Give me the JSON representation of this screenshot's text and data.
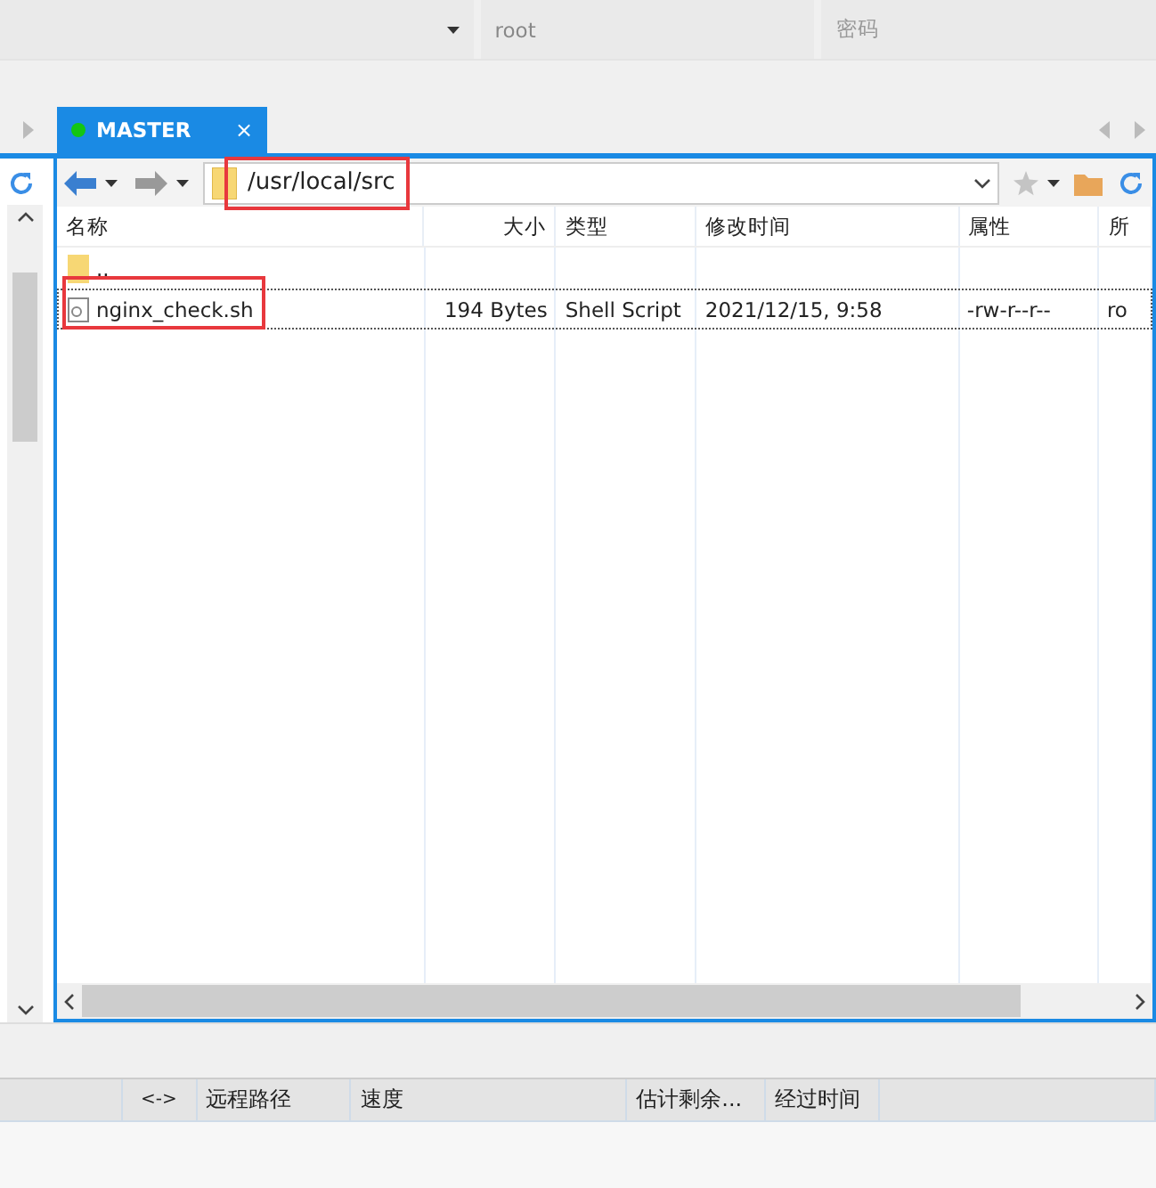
{
  "top_bar": {
    "username": "root",
    "password_placeholder": "密码"
  },
  "tab": {
    "label": "MASTER",
    "close": "×",
    "connected": true,
    "selected": true
  },
  "path_bar": {
    "path": "/usr/local/src"
  },
  "file_list": {
    "columns": [
      "名称",
      "大小",
      "类型",
      "修改时间",
      "属性",
      "所"
    ],
    "rows": [
      {
        "kind": "folder",
        "name": "..",
        "size": "",
        "type": "",
        "modified": "",
        "attributes": "",
        "owner": "",
        "selected": false
      },
      {
        "kind": "file",
        "name": "nginx_check.sh",
        "size": "194 Bytes",
        "type": "Shell Script",
        "modified": "2021/12/15, 9:58",
        "attributes": "-rw-r--r--",
        "owner": "ro",
        "selected": true
      }
    ]
  },
  "transfer_columns": [
    "<->",
    "远程路径",
    "速度",
    "估计剩余...",
    "经过时间"
  ]
}
